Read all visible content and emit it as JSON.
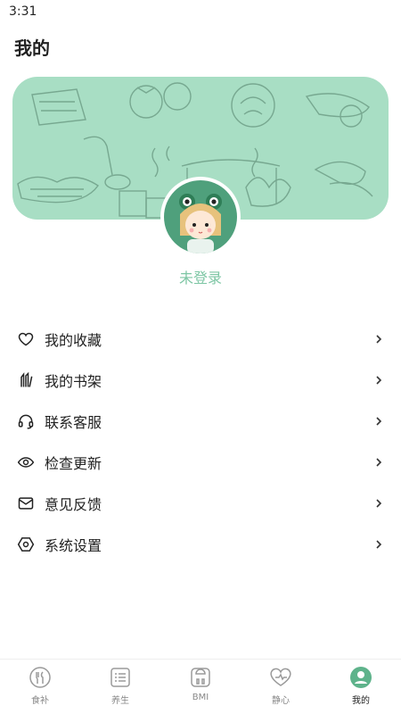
{
  "status_bar": {
    "time": "3:31"
  },
  "page": {
    "title": "我的"
  },
  "profile": {
    "login_status": "未登录"
  },
  "menu": [
    {
      "label": "我的收藏",
      "icon": "heart-icon"
    },
    {
      "label": "我的书架",
      "icon": "bookshelf-icon"
    },
    {
      "label": "联系客服",
      "icon": "headset-icon"
    },
    {
      "label": "检查更新",
      "icon": "update-eye-icon"
    },
    {
      "label": "意见反馈",
      "icon": "mail-icon"
    },
    {
      "label": "系统设置",
      "icon": "settings-icon"
    }
  ],
  "tabbar": {
    "items": [
      {
        "label": "食补",
        "icon": "food-icon"
      },
      {
        "label": "养生",
        "icon": "list-icon"
      },
      {
        "label": "BMI",
        "icon": "scale-icon"
      },
      {
        "label": "静心",
        "icon": "heart-pulse-icon"
      },
      {
        "label": "我的",
        "icon": "profile-icon",
        "active": true
      }
    ]
  },
  "colors": {
    "accent": "#4fa07c",
    "banner": "#a8dec4",
    "status_text": "#7dc6a4"
  }
}
